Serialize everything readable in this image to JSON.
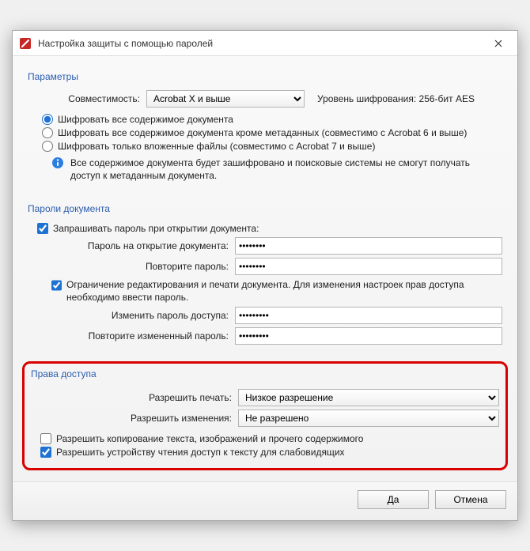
{
  "window": {
    "title": "Настройка защиты с помощью паролей"
  },
  "params": {
    "heading": "Параметры",
    "compat_label": "Совместимость:",
    "compat_value": "Acrobat X и выше",
    "encryption_label": "Уровень шифрования:",
    "encryption_value": "256-бит AES",
    "radio1": "Шифровать все содержимое документа",
    "radio2": "Шифровать все содержимое документа кроме метаданных (совместимо с Acrobat 6 и выше)",
    "radio3": "Шифровать только вложенные файлы (совместимо с Acrobat 7 и выше)",
    "info": "Все содержимое документа будет зашифровано и поисковые системы не смогут получать доступ к метаданным документа."
  },
  "passwords": {
    "heading": "Пароли документа",
    "require_open": "Запрашивать пароль при открытии документа:",
    "open_label": "Пароль на открытие документа:",
    "open_repeat": "Повторите пароль:",
    "open_value": "••••••••",
    "open_repeat_value": "••••••••",
    "restrict": "Ограничение редактирования и печати документа.  Для изменения настроек прав доступа необходимо ввести пароль.",
    "change_label": "Изменить пароль доступа:",
    "change_repeat": "Повторите измененный пароль:",
    "change_value": "•••••••••",
    "change_repeat_value": "•••••••••"
  },
  "perms": {
    "heading": "Права доступа",
    "print_label": "Разрешить печать:",
    "print_value": "Низкое разрешение",
    "edit_label": "Разрешить изменения:",
    "edit_value": "Не разрешено",
    "copy": "Разрешить копирование текста, изображений и прочего содержимого",
    "access": "Разрешить устройству чтения доступ к тексту для слабовидящих"
  },
  "buttons": {
    "ok": "Да",
    "cancel": "Отмена"
  }
}
